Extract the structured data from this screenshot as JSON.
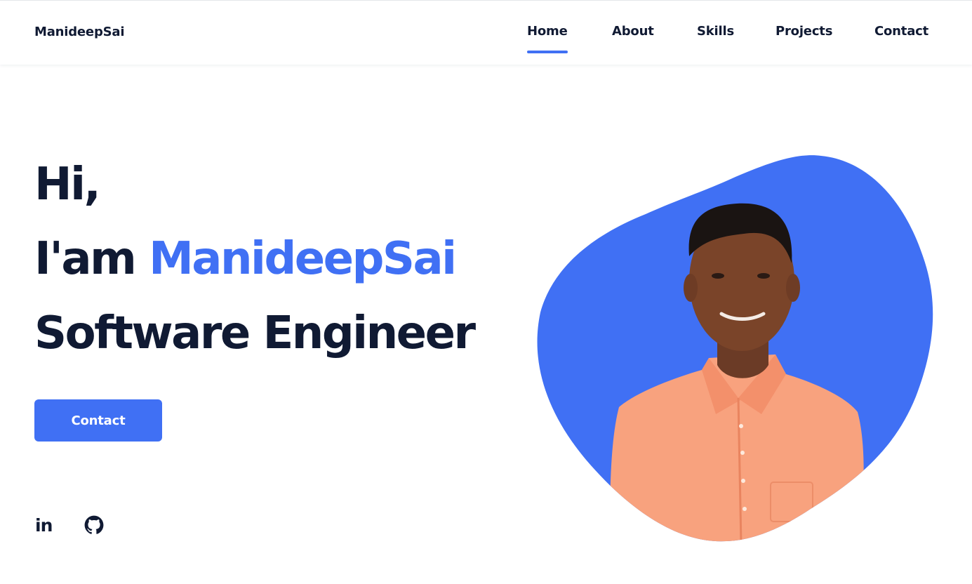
{
  "header": {
    "logo": "ManideepSai",
    "nav": [
      {
        "label": "Home",
        "active": true
      },
      {
        "label": "About",
        "active": false
      },
      {
        "label": "Skills",
        "active": false
      },
      {
        "label": "Projects",
        "active": false
      },
      {
        "label": "Contact",
        "active": false
      }
    ]
  },
  "hero": {
    "greeting": "Hi,",
    "intro_prefix": "I'am ",
    "name": "ManideepSai",
    "role": "Software Engineer",
    "contact_button": "Contact",
    "social": [
      {
        "icon": "linkedin-icon",
        "label": "in"
      },
      {
        "icon": "github-icon"
      }
    ],
    "photo": {
      "icon": "profile-photo",
      "blob_color": "#4070f4",
      "shirt_color": "#f8a27e"
    }
  },
  "colors": {
    "accent": "#4070f4",
    "text": "#101a33",
    "background": "#ffffff"
  }
}
